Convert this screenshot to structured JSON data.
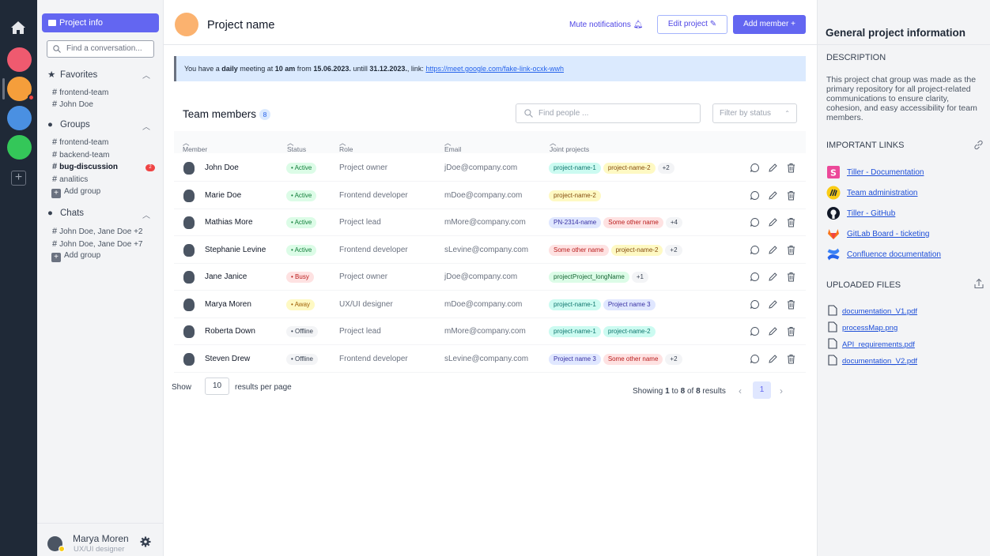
{
  "sidebar": {
    "project_info_label": "Project info",
    "search_placeholder": "Find a conversation...",
    "favorites": {
      "label": "Favorites",
      "items": [
        "frontend-team",
        "John Doe"
      ]
    },
    "groups": {
      "label": "Groups",
      "items": [
        "frontend-team",
        "backend-team",
        "bug-discussion",
        "analitics"
      ],
      "unread_badge": "2",
      "add_label": "Add group"
    },
    "chats": {
      "label": "Chats",
      "items": [
        "John Doe, Jane Doe +2",
        "John Doe, Jane Doe +7"
      ],
      "add_label": "Add group"
    },
    "user": {
      "name": "Marya Moren",
      "role": "UX/UI designer"
    }
  },
  "rail": {
    "workspace_colors": [
      "#ef5a6f",
      "#f59e3b",
      "#4a90e2",
      "#34c759"
    ]
  },
  "header": {
    "project_name": "Project name",
    "mute_label": "Mute notifications",
    "edit_label": "Edit project",
    "add_member_label": "Add member"
  },
  "banner": {
    "t1": "You have a ",
    "t2": "daily",
    "t3": " meeting at ",
    "t4": "10 am",
    "t5": " from ",
    "t6": "15.06.2023.",
    "t7": " untill ",
    "t8": "31.12.2023.",
    "t9": ", link: ",
    "link": "https://meet.google.com/fake-link-ocxk-wwh"
  },
  "team": {
    "title": "Team members",
    "count": "8",
    "find_placeholder": "Find people ...",
    "filter_label": "Filter by status",
    "columns": {
      "member": "Member",
      "status": "Status",
      "role": "Role",
      "email": "Email",
      "joint": "Joint projects"
    },
    "rows": [
      {
        "name": "John Doe",
        "status": "Active",
        "role": "Project owner",
        "email": "jDoe@company.com",
        "projects": [
          {
            "label": "project-name-1",
            "color": "teal"
          },
          {
            "label": "project-name-2",
            "color": "yellow"
          },
          {
            "label": "+2",
            "color": "more"
          }
        ]
      },
      {
        "name": "Marie Doe",
        "status": "Active",
        "role": "Frontend developer",
        "email": "mDoe@company.com",
        "projects": [
          {
            "label": "project-name-2",
            "color": "yellow"
          }
        ]
      },
      {
        "name": "Mathias More",
        "status": "Active",
        "role": "Project lead",
        "email": "mMore@company.com",
        "projects": [
          {
            "label": "PN-2314-name",
            "color": "blue"
          },
          {
            "label": "Some other name",
            "color": "red"
          },
          {
            "label": "+4",
            "color": "more"
          }
        ]
      },
      {
        "name": "Stephanie Levine",
        "status": "Active",
        "role": "Frontend developer",
        "email": "sLevine@company.com",
        "projects": [
          {
            "label": "Some other name",
            "color": "red"
          },
          {
            "label": "project-name-2",
            "color": "yellow"
          },
          {
            "label": "+2",
            "color": "more"
          }
        ]
      },
      {
        "name": "Jane Janice",
        "status": "Busy",
        "role": "Project owner",
        "email": "jDoe@company.com",
        "projects": [
          {
            "label": "projectProject_longName",
            "color": "green"
          },
          {
            "label": "+1",
            "color": "more"
          }
        ]
      },
      {
        "name": "Marya Moren",
        "status": "Away",
        "role": "UX/UI designer",
        "email": "mDoe@company.com",
        "projects": [
          {
            "label": "project-name-1",
            "color": "teal"
          },
          {
            "label": "Project name 3",
            "color": "blue"
          }
        ]
      },
      {
        "name": "Roberta Down",
        "status": "Offline",
        "role": "Project lead",
        "email": "mMore@company.com",
        "projects": [
          {
            "label": "project-name-1",
            "color": "teal"
          },
          {
            "label": "project-name-2",
            "color": "teal"
          }
        ]
      },
      {
        "name": "Steven Drew",
        "status": "Offline",
        "role": "Frontend developer",
        "email": "sLevine@company.com",
        "projects": [
          {
            "label": "Project name 3",
            "color": "blue"
          },
          {
            "label": "Some other name",
            "color": "red"
          },
          {
            "label": "+2",
            "color": "more"
          }
        ]
      }
    ]
  },
  "pagination": {
    "show_label": "Show",
    "per_page": "10",
    "rpp_label": "results per page",
    "s1": "Showing ",
    "s2": "1",
    "s3": " to ",
    "s4": "8",
    "s5": " of ",
    "s6": "8",
    "s7": " results",
    "current_page": "1"
  },
  "rpanel": {
    "title": "General project information",
    "description_label": "DESCRIPTION",
    "description": "This project chat group was made as the primary repository for all project-related communications to ensure clarity, cohesion, and easy accessibility for team members.",
    "links_label": "IMPORTANT LINKS",
    "links": [
      "Tiller - Documentation",
      "Team administration",
      "Tiller - GitHub",
      "GitLab Board - ticketing",
      "Confluence documentation"
    ],
    "files_label": "UPLOADED FILES",
    "files": [
      "documentation_V1.pdf",
      "processMap.png",
      "API_requirements.pdf",
      "documentation_V2.pdf"
    ]
  }
}
